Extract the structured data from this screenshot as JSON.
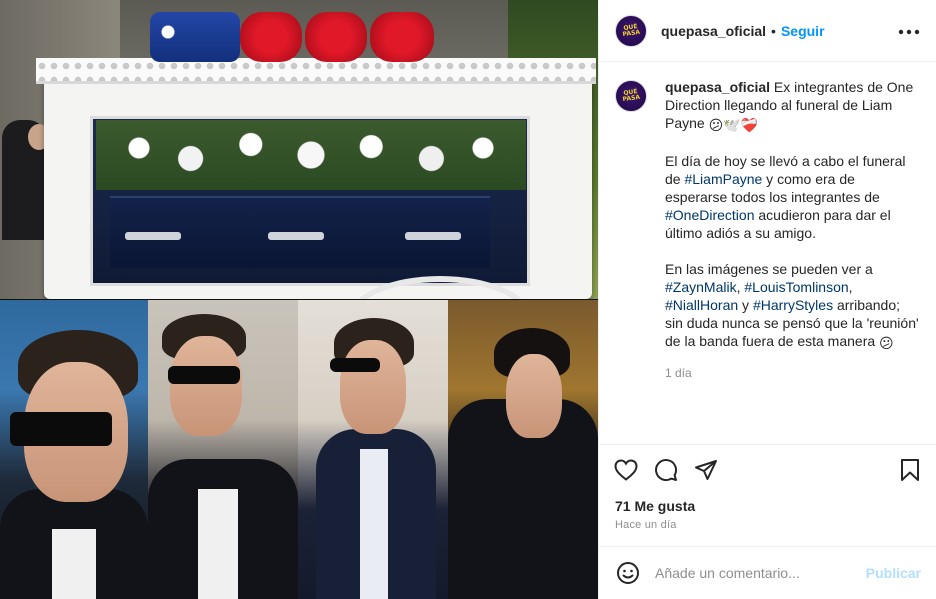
{
  "post": {
    "username": "quepasa_oficial",
    "follow_label": "Seguir",
    "dot": "•",
    "avatar_text": "QUÉ PASA"
  },
  "caption": {
    "username": "quepasa_oficial",
    "line1": " Ex integrantes de One Direction llegando al funeral de Liam Payne ",
    "line1_emojis": "😕🕊️❤️‍🩹",
    "p2_a": "El día de hoy se llevó a cabo el funeral de ",
    "p2_tag1": "#LiamPayne",
    "p2_b": " y como era de esperarse todos los integrantes de ",
    "p2_tag2": "#OneDirection",
    "p2_c": " acudieron para dar el último adiós a su amigo.",
    "p3_a": "En las imágenes se pueden ver a ",
    "p3_tag1": "#ZaynMalik",
    "p3_sep1": ", ",
    "p3_tag2": "#LouisTomlinson",
    "p3_sep2": ", ",
    "p3_tag3": "#NiallHoran",
    "p3_sep3": " y ",
    "p3_tag4": "#HarryStyles",
    "p3_b": " arribando; sin duda nunca se pensó que la 'reunión' de la banda fuera de esta manera ",
    "p3_emoji": "😕",
    "time": "1 día"
  },
  "actions": {
    "likes": "71 Me gusta",
    "time": "Hace un día"
  },
  "comment": {
    "placeholder": "Añade un comentario...",
    "publish_label": "Publicar"
  },
  "icons": {
    "like": "heart-icon",
    "comment": "comment-icon",
    "share": "send-icon",
    "save": "bookmark-icon",
    "more": "more-icon",
    "emoji": "smile-icon"
  },
  "colors": {
    "link": "#0095f6",
    "hashtag": "#00376b",
    "publish_disabled": "#b2dffc",
    "secondary_text": "#8e8e8e"
  }
}
